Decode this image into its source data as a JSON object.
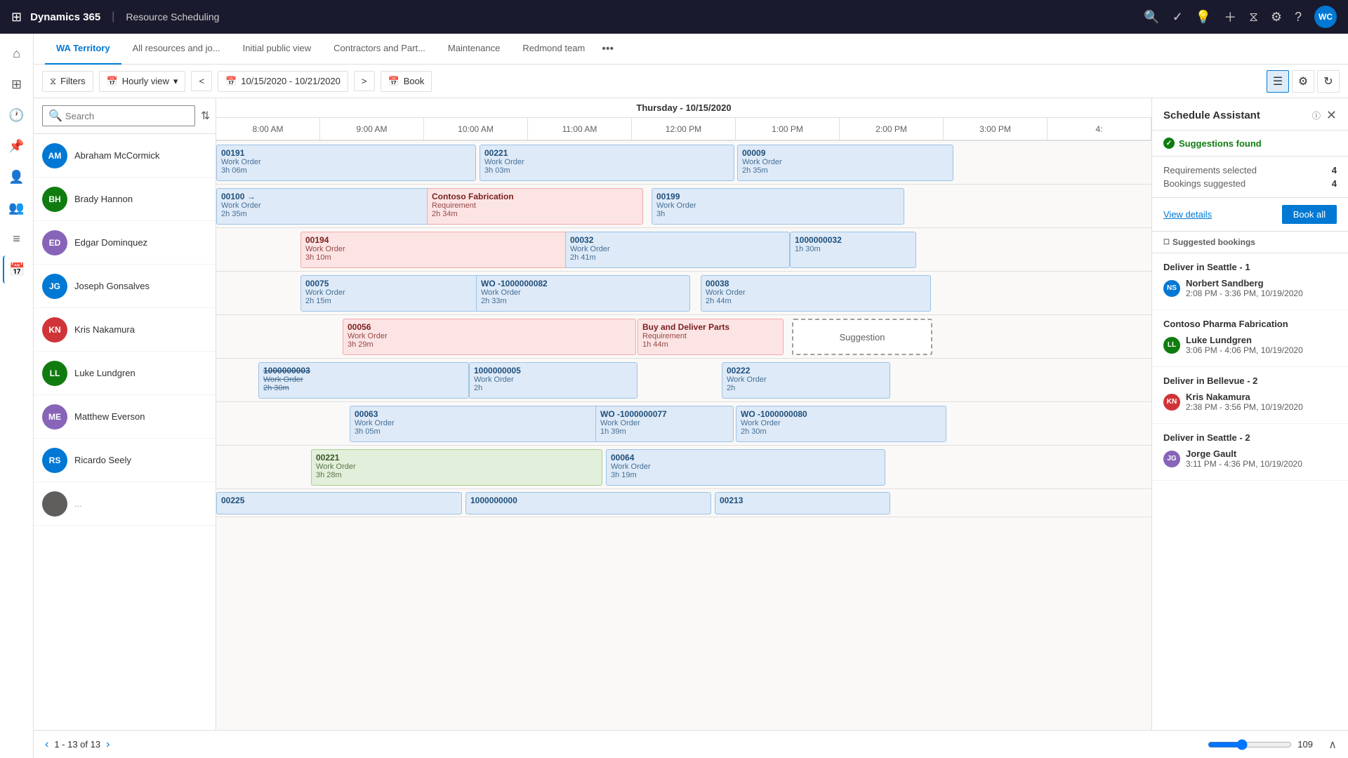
{
  "topbar": {
    "brand": "Dynamics 365",
    "separator": "|",
    "module": "Resource Scheduling",
    "avatar_initials": "WC"
  },
  "tabs": [
    {
      "id": "wa-territory",
      "label": "WA Territory",
      "active": true
    },
    {
      "id": "all-resources",
      "label": "All resources and jo...",
      "active": false
    },
    {
      "id": "initial-public",
      "label": "Initial public view",
      "active": false
    },
    {
      "id": "contractors",
      "label": "Contractors and Part...",
      "active": false
    },
    {
      "id": "maintenance",
      "label": "Maintenance",
      "active": false
    },
    {
      "id": "redmond",
      "label": "Redmond team",
      "active": false
    }
  ],
  "toolbar": {
    "filter_label": "Filters",
    "view_label": "Hourly view",
    "date_range": "10/15/2020 - 10/21/2020",
    "book_label": "Book"
  },
  "search": {
    "placeholder": "Search"
  },
  "date_header": "Thursday - 10/15/2020",
  "time_slots": [
    "8:00 AM",
    "9:00 AM",
    "10:00 AM",
    "11:00 AM",
    "12:00 PM",
    "1:00 PM",
    "2:00 PM",
    "3:00 PM",
    "4:"
  ],
  "resources": [
    {
      "id": "abraham",
      "name": "Abraham McCormick",
      "initials": "AM",
      "color": "#0078d4"
    },
    {
      "id": "brady",
      "name": "Brady Hannon",
      "initials": "BH",
      "color": "#107c10"
    },
    {
      "id": "edgar",
      "name": "Edgar Dominquez",
      "initials": "ED",
      "color": "#8764b8"
    },
    {
      "id": "joseph",
      "name": "Joseph Gonsalves",
      "initials": "JG",
      "color": "#0078d4"
    },
    {
      "id": "kris",
      "name": "Kris Nakamura",
      "initials": "KN",
      "color": "#d13438"
    },
    {
      "id": "luke",
      "name": "Luke Lundgren",
      "initials": "LL",
      "color": "#107c10"
    },
    {
      "id": "matthew",
      "name": "Matthew Everson",
      "initials": "ME",
      "color": "#8764b8"
    },
    {
      "id": "ricardo",
      "name": "Ricardo Seely",
      "initials": "RS",
      "color": "#0078d4"
    }
  ],
  "assistant": {
    "title": "Schedule Assistant",
    "status": "Suggestions found",
    "requirements_label": "Requirements selected",
    "requirements_value": "4",
    "bookings_label": "Bookings suggested",
    "bookings_value": "4",
    "view_details": "View details",
    "book_all": "Book all",
    "suggested_bookings_label": "Suggested bookings",
    "groups": [
      {
        "title": "Deliver in Seattle - 1",
        "person_name": "Norbert Sandberg",
        "person_initials": "NS",
        "person_color": "#0078d4",
        "time": "2:08 PM - 3:36 PM, 10/19/2020"
      },
      {
        "title": "Contoso Pharma Fabrication",
        "person_name": "Luke Lundgren",
        "person_initials": "LL",
        "person_color": "#107c10",
        "time": "3:06 PM - 4:06 PM, 10/19/2020"
      },
      {
        "title": "Deliver in Bellevue - 2",
        "person_name": "Kris Nakamura",
        "person_initials": "KN",
        "person_color": "#d13438",
        "time": "2:38 PM - 3:56 PM, 10/19/2020"
      },
      {
        "title": "Deliver in Seattle - 2",
        "person_name": "Jorge Gault",
        "person_initials": "JG",
        "person_color": "#8764b8",
        "time": "3:11 PM - 4:36 PM, 10/19/2020"
      }
    ]
  },
  "pagination": {
    "text": "1 - 13 of 13"
  },
  "zoom": {
    "value": "109"
  }
}
